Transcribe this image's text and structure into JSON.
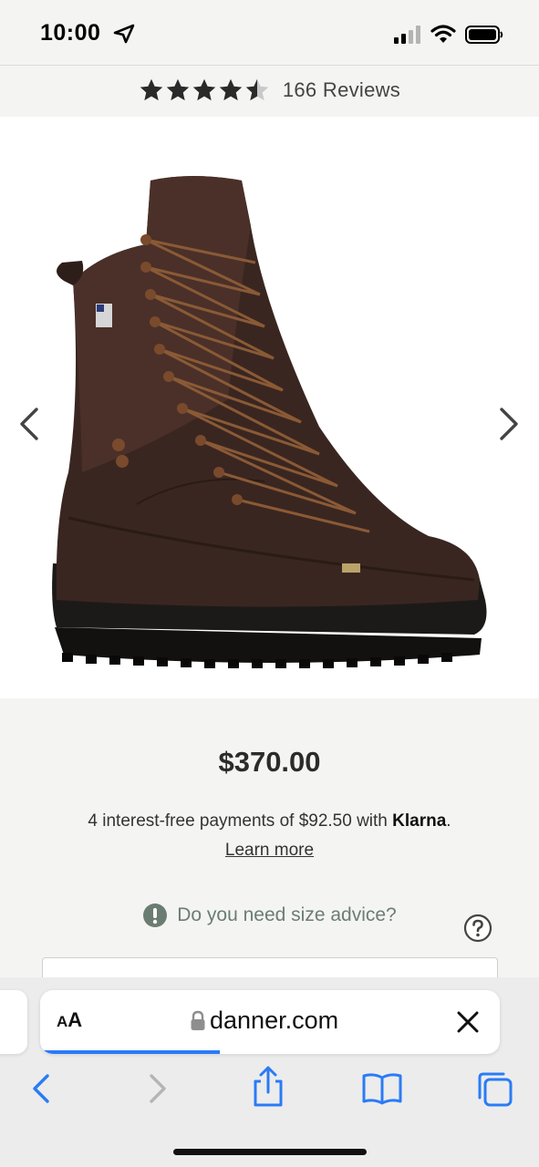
{
  "status_bar": {
    "time": "10:00"
  },
  "rating": {
    "stars": 4.5,
    "reviews_label": "166 Reviews"
  },
  "product": {
    "price": "$370.00",
    "klarna_prefix": "4 interest-free payments of $92.50 with ",
    "klarna_brand": "Klarna",
    "klarna_suffix": ".",
    "learn_more": "Learn more",
    "size_advice": "Do you need size advice?"
  },
  "browser": {
    "aa_label_small": "A",
    "aa_label_large": "A",
    "url": "danner.com",
    "load_progress": 0.39
  },
  "colors": {
    "accent": "#2a7bf6",
    "sage": "#6b7d72"
  }
}
